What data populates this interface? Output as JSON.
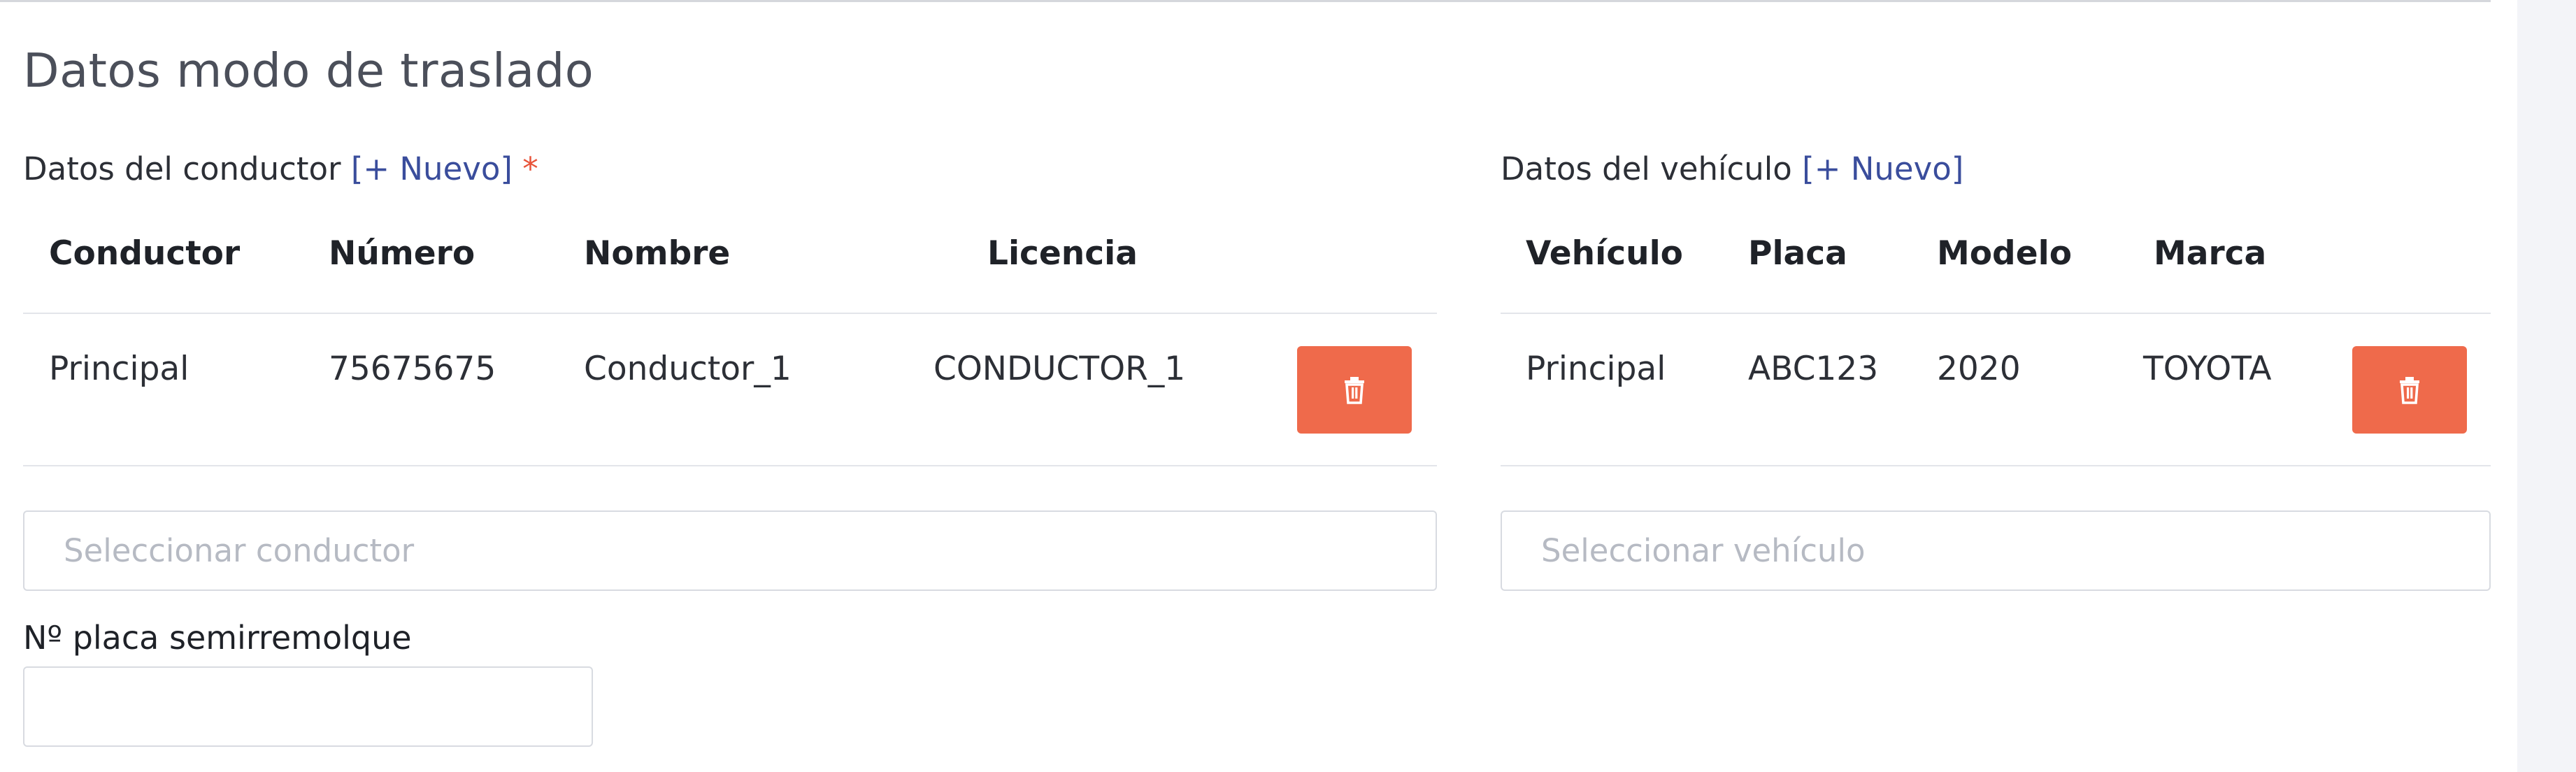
{
  "section": {
    "title": "Datos modo de traslado"
  },
  "conductor": {
    "label": "Datos del conductor",
    "new_link": "[+ Nuevo]",
    "required_mark": "*",
    "headers": [
      "Conductor",
      "Número",
      "Nombre",
      "Licencia"
    ],
    "row": {
      "conductor": "Principal",
      "numero": "75675675",
      "nombre": "Conductor_1",
      "licencia": "CONDUCTOR_1"
    },
    "select_placeholder": "Seleccionar conductor"
  },
  "vehiculo": {
    "label": "Datos del vehículo",
    "new_link": "[+ Nuevo]",
    "headers": [
      "Vehículo",
      "Placa",
      "Modelo",
      "Marca"
    ],
    "row": {
      "vehiculo": "Principal",
      "placa": "ABC123",
      "modelo": "2020",
      "marca": "TOYOTA"
    },
    "select_placeholder": "Seleccionar vehículo"
  },
  "semirremolque": {
    "label": "Nº placa semirremolque",
    "value": ""
  },
  "colors": {
    "accent_link": "#3a4d9c",
    "delete_button": "#ef6a4b",
    "required": "#e8543a"
  },
  "icons": {
    "delete": "trash-icon"
  }
}
